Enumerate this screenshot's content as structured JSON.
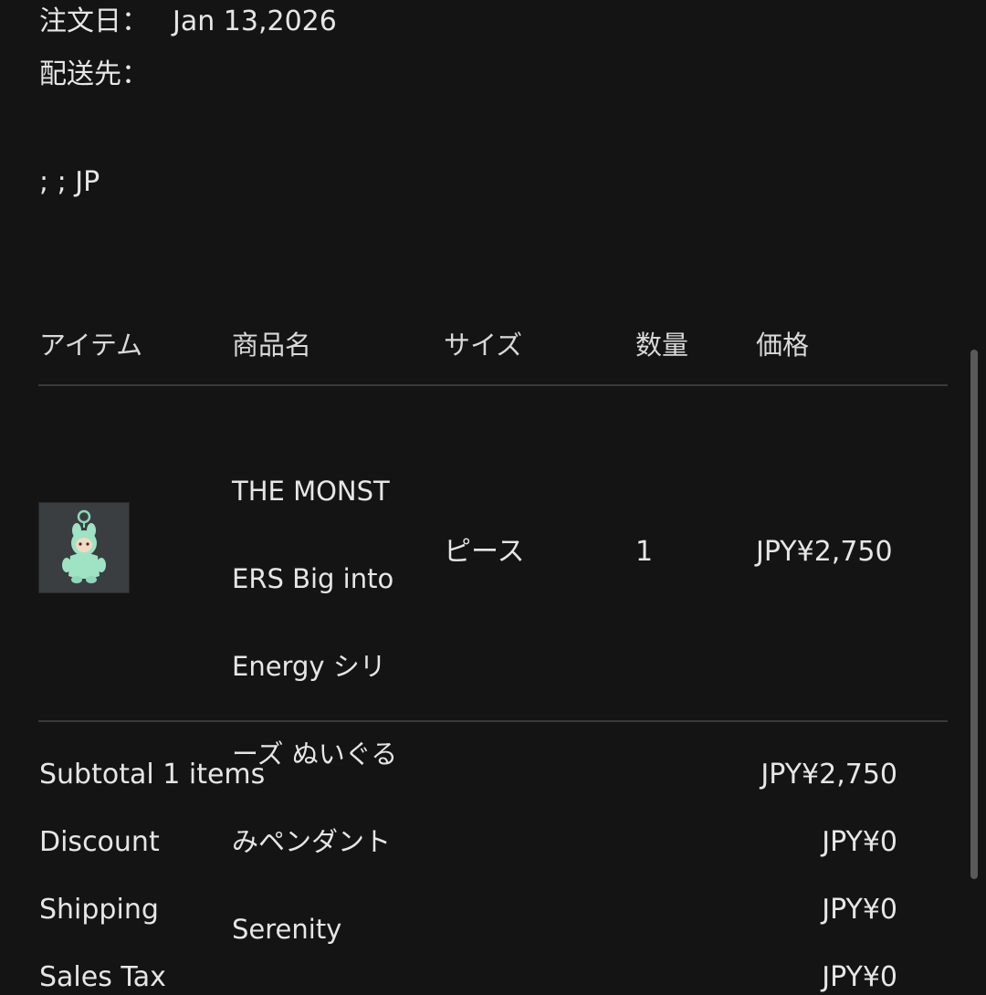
{
  "order": {
    "date_label": "注文日：",
    "date_value": "Jan 13,2026",
    "ship_label": "配送先：",
    "address_line": "; ; JP"
  },
  "table": {
    "headers": {
      "item": "アイテム",
      "name": "商品名",
      "size": "サイズ",
      "qty": "数量",
      "price": "価格"
    },
    "row": {
      "thumbnail_icon": "plush-keychain-icon",
      "name_lines": [
        "THE MONST",
        "ERS Big into",
        "Energy シリ",
        "ーズ ぬいぐる",
        "みペンダント",
        "Serenity"
      ],
      "size": "ピース",
      "qty": "1",
      "price": "JPY¥2,750"
    }
  },
  "summary": {
    "subtotal_label": "Subtotal 1 items",
    "subtotal_value": "JPY¥2,750",
    "discount_label": "Discount",
    "discount_value": "JPY¥0",
    "shipping_label": "Shipping",
    "shipping_value": "JPY¥0",
    "tax_label": "Sales Tax",
    "tax_value": "JPY¥0"
  },
  "colors": {
    "background": "#141414",
    "text": "#e6e6e6",
    "divider": "#3a3a3a",
    "figure_mint": "#9fe3c4"
  }
}
